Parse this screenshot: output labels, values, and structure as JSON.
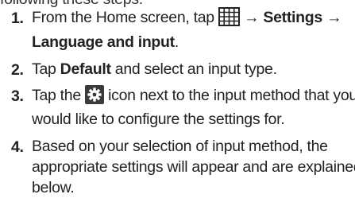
{
  "intro": "following these steps:",
  "steps": [
    {
      "number": "1.",
      "text_a": "From the Home screen, tap",
      "arrow_1": "→",
      "settings": "Settings",
      "arrow_2": "→",
      "language": "Language and input",
      "period": ".",
      "icon": "apps-grid-icon"
    },
    {
      "number": "2.",
      "text_a": "Tap",
      "default": "Default",
      "text_b": "and select an input type."
    },
    {
      "number": "3.",
      "text_a": "Tap the",
      "text_b": "icon next to the input method that you",
      "text_c": "would like to configure the settings for.",
      "icon": "gear-icon",
      "icon_color": "#3a3a3a"
    },
    {
      "number": "4.",
      "line_1": "Based on your selection of input method, the",
      "line_2": "appropriate settings will appear and are explained",
      "line_3": "below."
    }
  ]
}
